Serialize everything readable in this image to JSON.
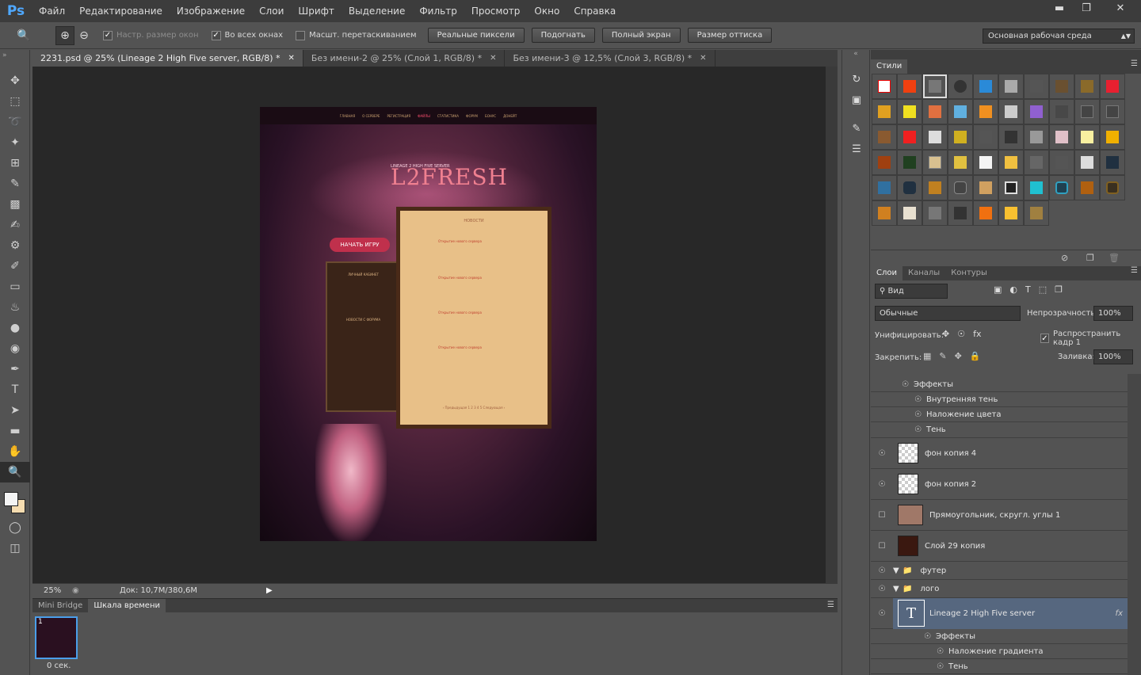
{
  "app": {
    "logo": "Ps"
  },
  "menu": [
    "Файл",
    "Редактирование",
    "Изображение",
    "Слои",
    "Шрифт",
    "Выделение",
    "Фильтр",
    "Просмотр",
    "Окно",
    "Справка"
  ],
  "window": {
    "minimize": "▬",
    "restore": "❐",
    "close": "✕"
  },
  "options": {
    "resize_windows": "Настр. размер окон",
    "all_windows": "Во всех окнах",
    "scrubby_zoom": "Масшт. перетаскиванием",
    "actual_pixels": "Реальные пиксели",
    "fit_screen": "Подогнать",
    "fill_screen": "Полный экран",
    "print_size": "Размер оттиска",
    "workspace": "Основная рабочая среда"
  },
  "tabs": [
    {
      "label": "2231.psd @ 25% (Lineage 2 High  Five server, RGB/8) *",
      "active": true
    },
    {
      "label": "Без имени-2 @ 25% (Слой 1, RGB/8) *",
      "active": false
    },
    {
      "label": "Без имени-3 @ 12,5% (Слой 3, RGB/8) *",
      "active": false
    }
  ],
  "document": {
    "logo": "L2FRESH",
    "tagline": "LINEAGE 2 HIGH FIVE SERVER",
    "nav": [
      "ГЛАВНАЯ",
      "О СЕРВЕРЕ",
      "РЕГИСТРАЦИЯ",
      "ФАЙЛЫ",
      "СТАТИСТИКА",
      "ФОРУМ",
      "БОНУС",
      "ДОНЕЙТ"
    ],
    "news_title": "НОВОСТИ",
    "news_item_title": "Открытие нового сервера",
    "start_button": "НАЧАТЬ ИГРУ",
    "cabinet_title": "ЛИЧНЫЙ КАБИНЕТ",
    "forum_title": "НОВОСТИ С ФОРУМА",
    "pager": "‹ Предыдущая   1 2 3 4 5   Следующая ›"
  },
  "status": {
    "zoom": "25%",
    "doc": "Док: 10,7M/380,6M"
  },
  "bottom": {
    "tabs": [
      "Mini Bridge",
      "Шкала времени"
    ],
    "frame_num": "1",
    "frame_time": "0 сек."
  },
  "styles": {
    "title": "Стили"
  },
  "layers": {
    "tabs": [
      "Слои",
      "Каналы",
      "Контуры"
    ],
    "filter": "Вид",
    "blend": "Обычные",
    "opacity_label": "Непрозрачность:",
    "opacity": "100%",
    "unify_label": "Унифицировать:",
    "propagate": "Распространить кадр 1",
    "lock_label": "Закрепить:",
    "fill_label": "Заливка:",
    "fill": "100%",
    "effects": "Эффекты",
    "inner_shadow": "Внутренняя тень",
    "color_overlay": "Наложение цвета",
    "shadow": "Тень",
    "layer1": "фон копия 4",
    "layer2": "фон копия 2",
    "layer3": "Прямоугольник, скругл. углы 1",
    "layer4": "Слой 29 копия",
    "group1": "футер",
    "group2": "лого",
    "text_layer": "Lineage 2 High  Five server",
    "fx": "fx",
    "effects2": "Эффекты",
    "gradient_overlay": "Наложение градиента",
    "shadow2": "Тень"
  },
  "colors": {
    "accent": "#4a9eea",
    "selected_layer": "#56677f",
    "fg": "#f4f4f4",
    "bg": "#f5dcb0"
  }
}
